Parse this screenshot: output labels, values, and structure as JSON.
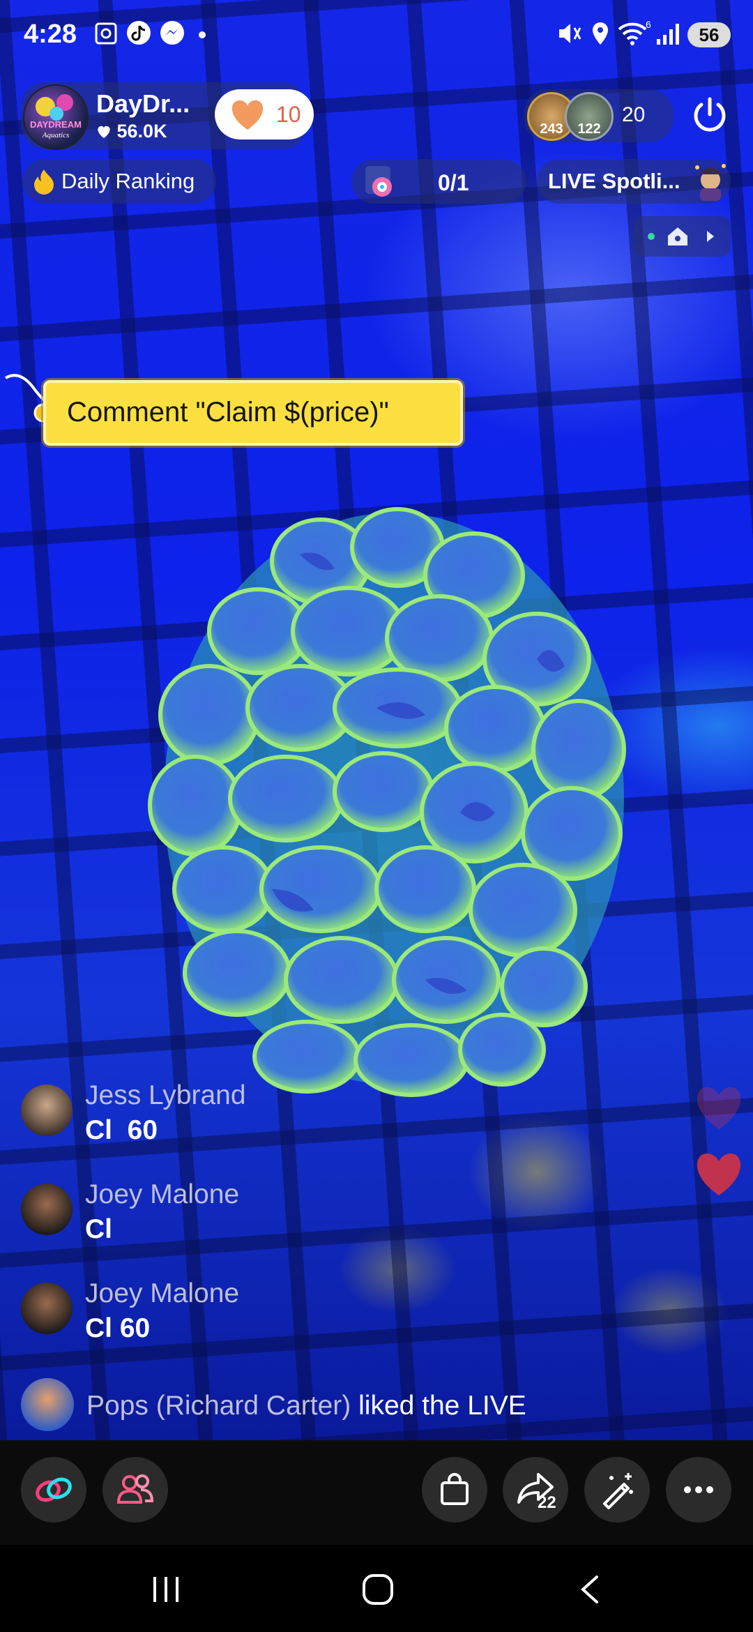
{
  "status_bar": {
    "time": "4:28",
    "battery": "56",
    "network": "6"
  },
  "host": {
    "name": "DayDr...",
    "followers": "56.0K",
    "like_count": "10",
    "logo_text_top": "DAYDREAM",
    "logo_text_bottom": "Aquatics"
  },
  "viewers": {
    "avatar_1_count": "243",
    "avatar_2_count": "122",
    "total": "20"
  },
  "top_row": {
    "ranking_label": "Daily Ranking",
    "goal_progress": "0/1",
    "spotlight_label": "LIVE Spotli..."
  },
  "comment_tag": {
    "text": "Comment \"Claim $(price)\""
  },
  "chat": [
    {
      "user": "Jess Lybrand",
      "message": "Cl  60"
    },
    {
      "user": "Joey Malone",
      "message": "Cl"
    },
    {
      "user": "Joey Malone",
      "message": "Cl 60"
    }
  ],
  "activity": {
    "user": "Pops (Richard Carter)",
    "action": " liked the LIVE"
  },
  "bottom_bar": {
    "share_count": "22",
    "buttons": [
      "link-icon",
      "people-icon",
      "shopping-bag-icon",
      "share-icon",
      "magic-wand-icon",
      "more-icon"
    ]
  },
  "colors": {
    "tag_yellow": "#fce041",
    "like_orange": "#f39a5e",
    "heart_red": "#c0324d",
    "link_pink": "#ff3b7a",
    "link_cyan": "#25e2f2"
  }
}
